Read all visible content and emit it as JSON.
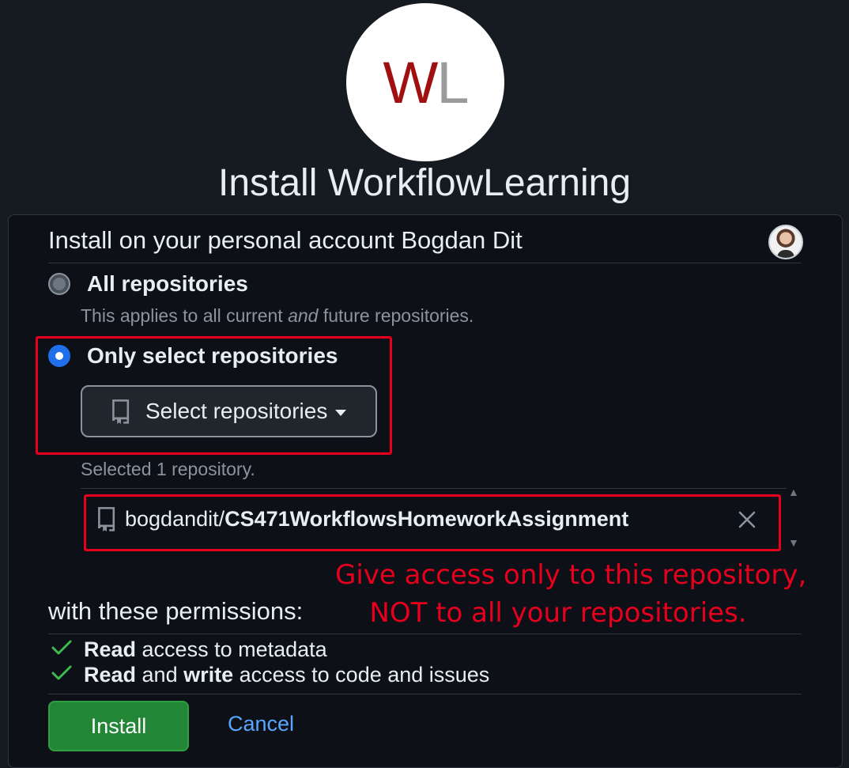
{
  "app": {
    "logo_letter_1": "W",
    "logo_letter_2": "L",
    "title": "Install WorkflowLearning"
  },
  "account": {
    "heading": "Install on your personal account Bogdan Dit"
  },
  "options": {
    "all": {
      "label": "All repositories",
      "desc_before": "This applies to all current ",
      "desc_em": "and",
      "desc_after": " future repositories.",
      "checked": false
    },
    "select": {
      "label": "Only select repositories",
      "checked": true
    }
  },
  "select_button": {
    "label": "Select repositories",
    "icon": "repo-icon"
  },
  "selection": {
    "count_text": "Selected 1 repository.",
    "repos": [
      {
        "owner": "bogdandit/",
        "name": "CS471WorkflowsHomeworkAssignment"
      }
    ]
  },
  "annotation": {
    "line1": "Give access only to this repository,",
    "line2": "NOT to all your repositories.",
    "color": "#e6001e"
  },
  "permissions": {
    "heading": "with these permissions:",
    "items": [
      {
        "b1": "Read",
        "t1": " access to metadata",
        "b2": "",
        "t2": ""
      },
      {
        "b1": "Read",
        "t1": " and ",
        "b2": "write",
        "t2": " access to code and issues"
      }
    ]
  },
  "actions": {
    "install": "Install",
    "cancel": "Cancel"
  },
  "colors": {
    "background": "#161b22",
    "card": "#0d1117",
    "primary_button": "#238636",
    "link": "#58a6ff",
    "radio_selected": "#1f6feb"
  }
}
